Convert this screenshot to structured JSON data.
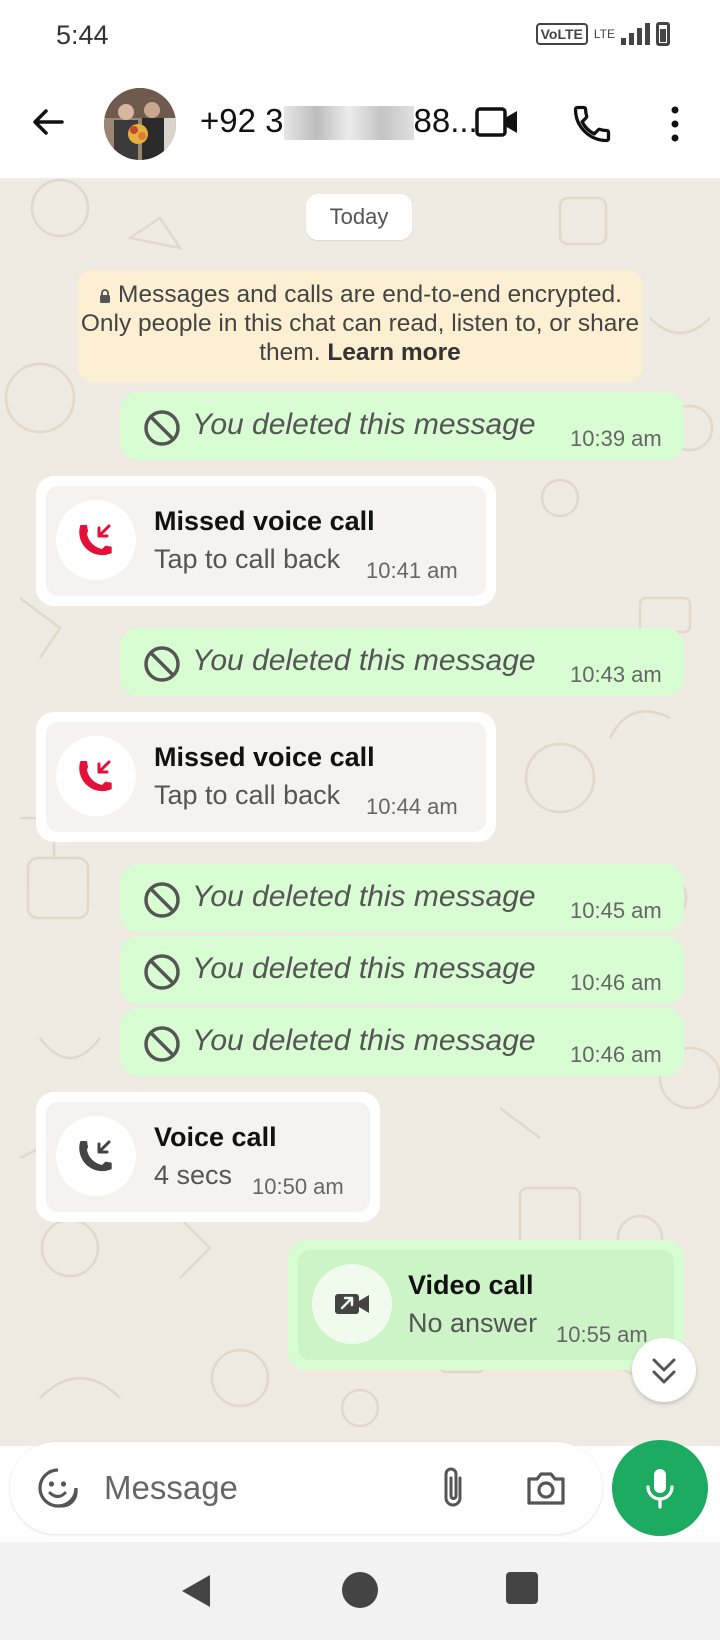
{
  "status_bar": {
    "time": "5:44",
    "volte": "VoLTE",
    "lte": "LTE"
  },
  "header": {
    "contact_prefix": "+92 3",
    "contact_suffix": "88..."
  },
  "chat": {
    "date_chip": "Today",
    "e2e_notice": "Messages and calls are end-to-end encrypted. Only people in this chat can read, listen to, or share them.",
    "e2e_link": "Learn more",
    "messages": [
      {
        "type": "deleted",
        "text": "You deleted this message",
        "time": "10:39 am"
      },
      {
        "type": "missed_call",
        "title": "Missed voice call",
        "subtitle": "Tap to call back",
        "time": "10:41 am"
      },
      {
        "type": "deleted",
        "text": "You deleted this message",
        "time": "10:43 am"
      },
      {
        "type": "missed_call",
        "title": "Missed voice call",
        "subtitle": "Tap to call back",
        "time": "10:44 am"
      },
      {
        "type": "deleted",
        "text": "You deleted this message",
        "time": "10:45 am"
      },
      {
        "type": "deleted",
        "text": "You deleted this message",
        "time": "10:46 am"
      },
      {
        "type": "deleted",
        "text": "You deleted this message",
        "time": "10:46 am"
      },
      {
        "type": "voice_call",
        "title": "Voice call",
        "subtitle": "4 secs",
        "time": "10:50 am"
      },
      {
        "type": "video_call",
        "title": "Video call",
        "subtitle": "No answer",
        "time": "10:55 am"
      }
    ]
  },
  "composer": {
    "placeholder": "Message"
  },
  "colors": {
    "accent": "#1daa61",
    "outgoing_bubble": "#d9fdd3",
    "missed_call_red": "#e5103a",
    "chat_background": "#efeae2"
  }
}
